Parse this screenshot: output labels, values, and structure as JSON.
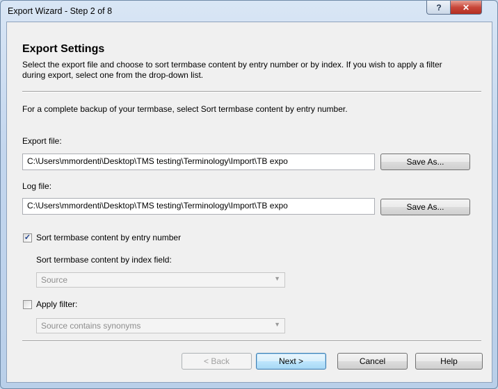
{
  "window": {
    "title": "Export Wizard - Step 2 of 8",
    "help_glyph": "?",
    "close_glyph": "✕"
  },
  "header": {
    "title": "Export Settings",
    "description": "Select the export file and choose to sort termbase content by entry number or by index. If you wish to apply a filter during export, select one from the drop-down list."
  },
  "info_text": "For a complete backup of your termbase, select Sort termbase content by entry number.",
  "export_file": {
    "label": "Export file:",
    "value": "C:\\Users\\mmordenti\\Desktop\\TMS testing\\Terminology\\Import\\TB expo",
    "save_as_label": "Save As..."
  },
  "log_file": {
    "label": "Log file:",
    "value": "C:\\Users\\mmordenti\\Desktop\\TMS testing\\Terminology\\Import\\TB expo",
    "save_as_label": "Save As..."
  },
  "sort_by_entry": {
    "checked": true,
    "check_glyph": "✓",
    "label": "Sort termbase content by entry number"
  },
  "sort_by_index": {
    "label": "Sort termbase content by index field:",
    "selected": "Source"
  },
  "apply_filter": {
    "checked": false,
    "label": "Apply filter:",
    "selected": "Source contains synonyms"
  },
  "footer": {
    "back_label": "< Back",
    "next_label": "Next >",
    "cancel_label": "Cancel",
    "help_label": "Help"
  }
}
